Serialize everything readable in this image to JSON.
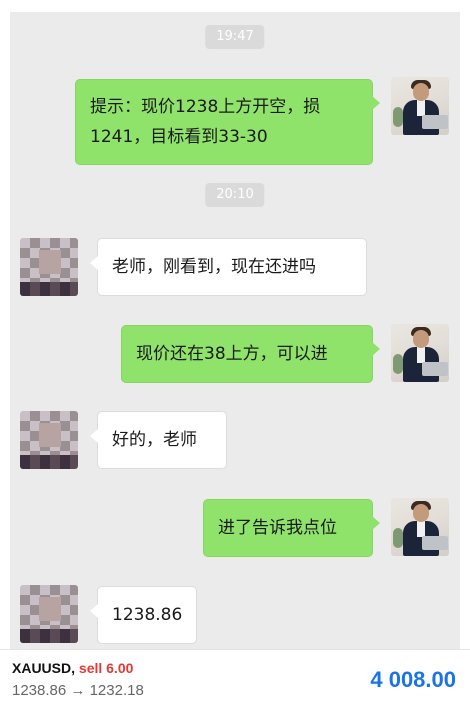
{
  "chat": {
    "timestamps": [
      "19:47",
      "20:10"
    ],
    "messages": [
      {
        "sender": "teacher",
        "lines": [
          "提示：现价1238上方开空，损",
          "1241，目标看到33-30"
        ]
      },
      {
        "sender": "student",
        "text": "老师，刚看到，现在还进吗"
      },
      {
        "sender": "teacher",
        "text": "现价还在38上方，可以进"
      },
      {
        "sender": "student",
        "text": "好的，老师"
      },
      {
        "sender": "teacher",
        "text": "进了告诉我点位"
      },
      {
        "sender": "student",
        "text": "1238.86"
      }
    ]
  },
  "trade": {
    "symbol": "XAUUSD,",
    "action": "sell 6.00",
    "open_price": "1238.86",
    "arrow": "→",
    "close_price": "1232.18",
    "profit": "4 008.00",
    "profit_color": "#1a73e8",
    "action_color": "#e53935"
  },
  "colors": {
    "chat_background": "#ebebeb",
    "sent_bubble": "#8fe26a",
    "received_bubble": "#ffffff"
  }
}
